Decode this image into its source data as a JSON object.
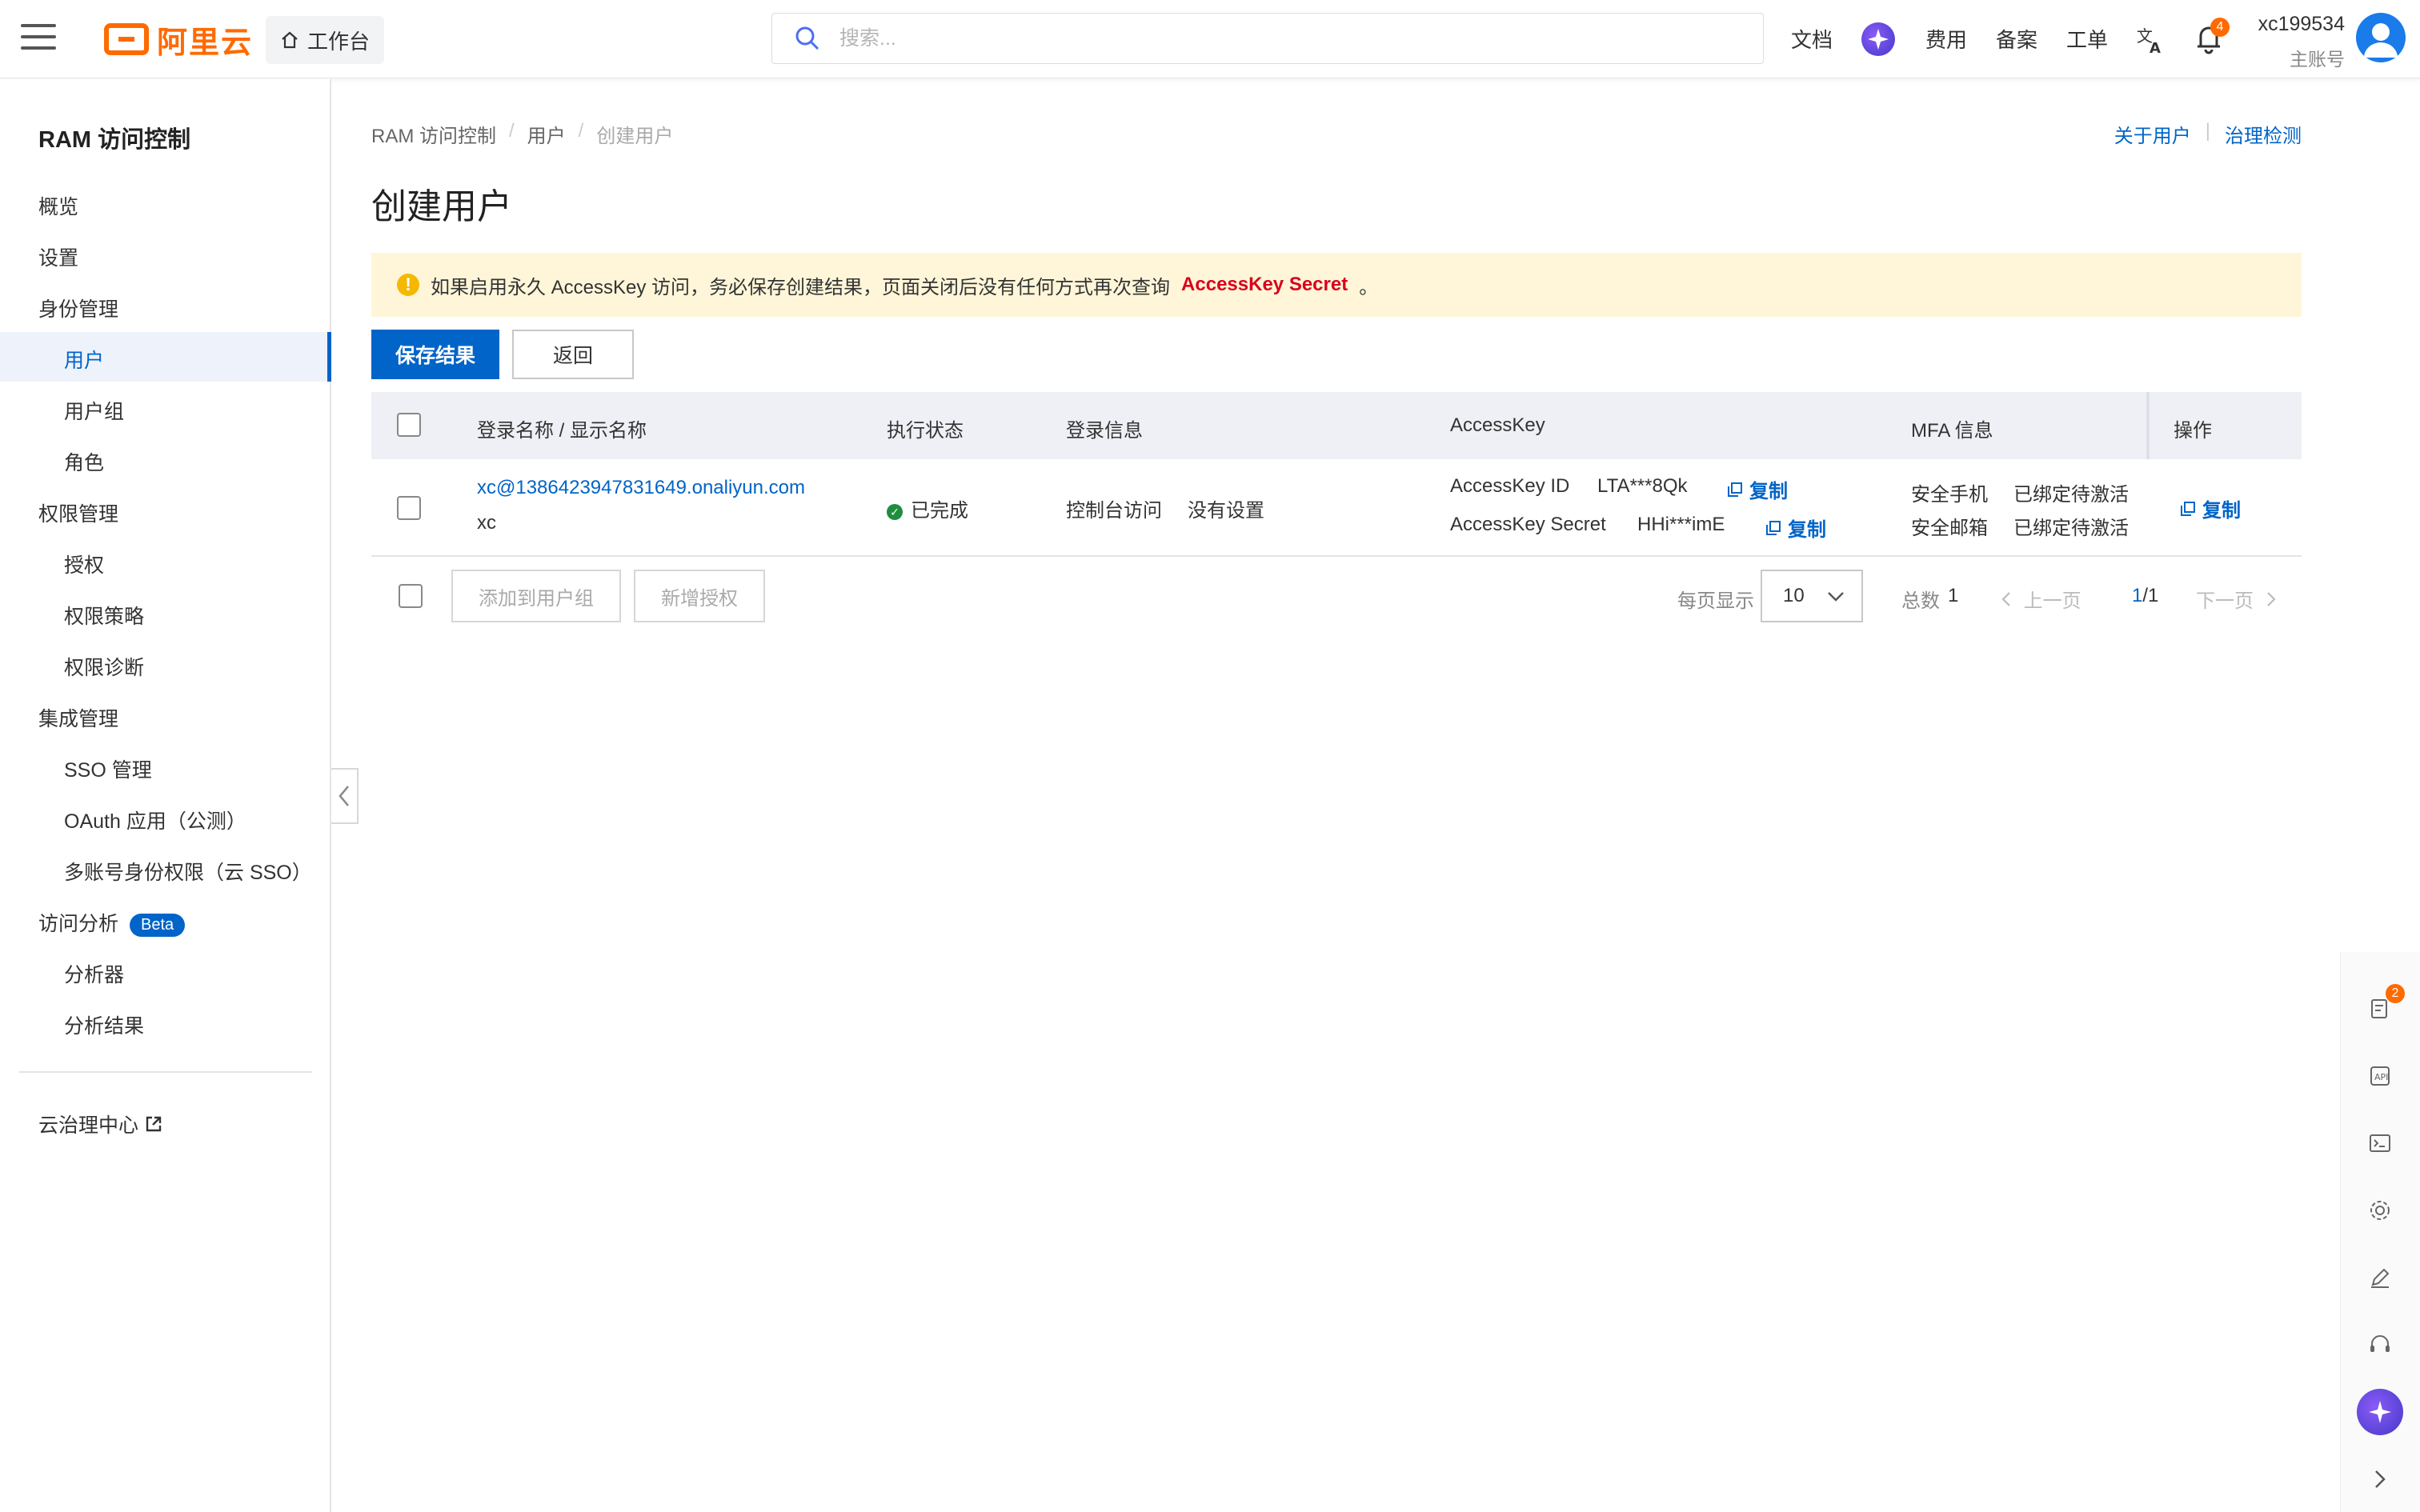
{
  "header": {
    "brand": "阿里云",
    "workbench": "工作台",
    "search_placeholder": "搜索...",
    "nav": [
      "文档",
      "费用",
      "备案",
      "工单"
    ],
    "notification_count": "4",
    "account_name": "xc199534",
    "account_type": "主账号"
  },
  "sidebar": {
    "title": "RAM 访问控制",
    "items": [
      {
        "label": "概览"
      },
      {
        "label": "设置"
      },
      {
        "label": "身份管理"
      },
      {
        "label": "用户"
      },
      {
        "label": "用户组"
      },
      {
        "label": "角色"
      },
      {
        "label": "权限管理"
      },
      {
        "label": "授权"
      },
      {
        "label": "权限策略"
      },
      {
        "label": "权限诊断"
      },
      {
        "label": "集成管理"
      },
      {
        "label": "SSO 管理"
      },
      {
        "label": "OAuth 应用（公测）"
      },
      {
        "label": "多账号身份权限（云 SSO）"
      },
      {
        "label": "访问分析"
      },
      {
        "label": "分析器"
      },
      {
        "label": "分析结果"
      }
    ],
    "beta_badge": "Beta",
    "governance": "云治理中心"
  },
  "breadcrumb": [
    "RAM 访问控制",
    "用户",
    "创建用户"
  ],
  "top_links": [
    "关于用户",
    "治理检测"
  ],
  "page_title": "创建用户",
  "alert": {
    "text": "如果启用永久 AccessKey 访问，务必保存创建结果，页面关闭后没有任何方式再次查询",
    "highlight": "AccessKey Secret",
    "end": "。"
  },
  "buttons": {
    "save": "保存结果",
    "back": "返回"
  },
  "table": {
    "columns": [
      "登录名称 / 显示名称",
      "执行状态",
      "登录信息",
      "AccessKey",
      "MFA 信息",
      "操作"
    ],
    "row": {
      "login_name": "xc@1386423947831649.onaliyun.com",
      "display_name": "xc",
      "status": "已完成",
      "login_info_label": "控制台访问",
      "login_info_value": "没有设置",
      "ak_id_label": "AccessKey ID",
      "ak_id_value": "LTA***8Qk",
      "ak_secret_label": "AccessKey Secret",
      "ak_secret_value": "HHi***imE",
      "copy_label": "复制",
      "mfa_phone_label": "安全手机",
      "mfa_phone_value": "已绑定待激活",
      "mfa_email_label": "安全邮箱",
      "mfa_email_value": "已绑定待激活",
      "op_copy": "复制"
    }
  },
  "footer": {
    "add_to_group": "添加到用户组",
    "add_auth": "新增授权",
    "per_page_label": "每页显示",
    "per_page_value": "10",
    "total_label": "总数",
    "total_value": "1",
    "prev": "上一页",
    "page_current": "1",
    "page_total": "/1",
    "next": "下一页"
  },
  "dock": {
    "cart_badge": "2"
  },
  "colors": {
    "brand": "#ff6a00",
    "primary": "#0064c8",
    "alert_bg": "#fff6d9",
    "secret": "#d9001b"
  }
}
